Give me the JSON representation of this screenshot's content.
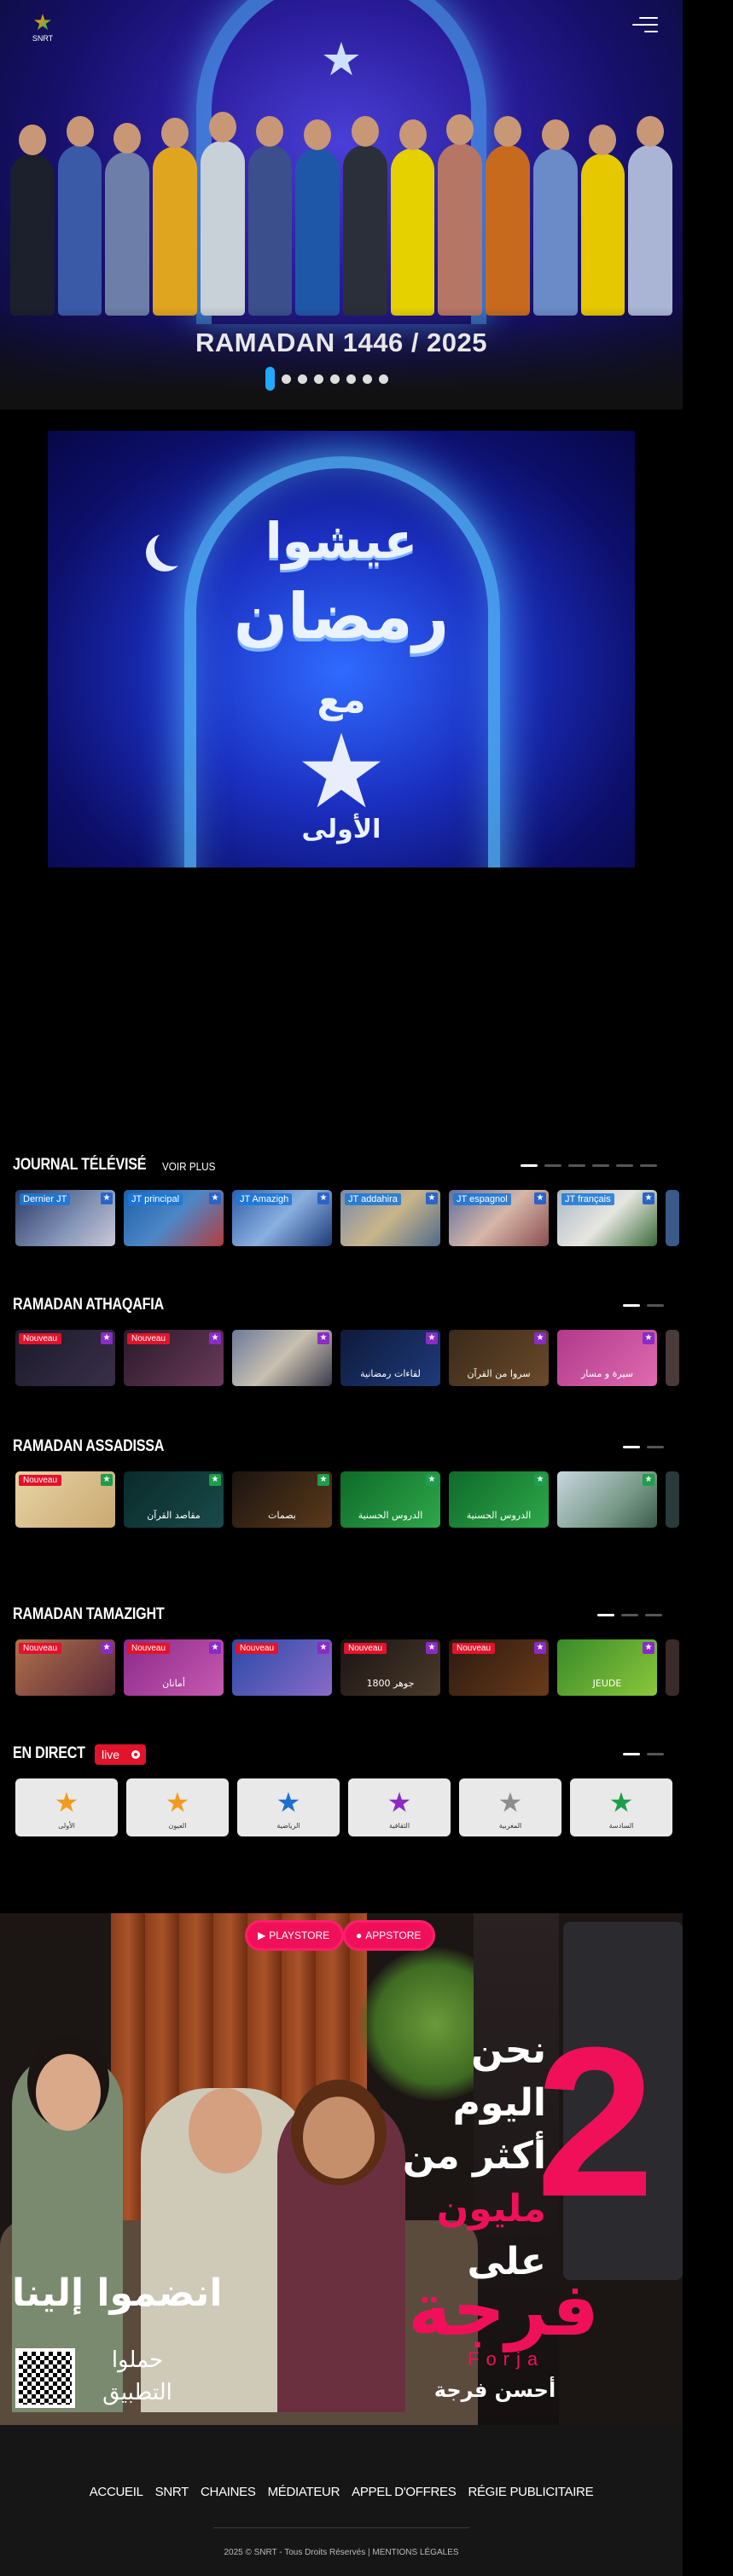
{
  "header": {
    "logo_text": "SNRT",
    "logo_icon": "snrt-star-logo",
    "menu_icon": "menu-icon"
  },
  "hero": {
    "caption": "RAMADAN 1446 / 2025",
    "slide_count": 8,
    "active_slide": 1,
    "emblem_text": "الأولى"
  },
  "poster": {
    "line1": "عيشوا",
    "line2": "رمضان",
    "line3": "مع",
    "line4": "الأولى"
  },
  "sections": {
    "journal": {
      "title": "JOURNAL TÉLÉVISÉ",
      "more": "VOIR PLUS",
      "cards": [
        {
          "label": "Dernier JT"
        },
        {
          "label": "JT principal"
        },
        {
          "label": "JT Amazigh"
        },
        {
          "label": "JT addahira"
        },
        {
          "label": "JT espagnol"
        },
        {
          "label": "JT français"
        }
      ]
    },
    "athaqafia": {
      "title": "RAMADAN ATHAQAFIA",
      "cards": [
        {
          "badge": "Nouveau",
          "caption": ""
        },
        {
          "badge": "Nouveau",
          "caption": ""
        },
        {
          "badge": "",
          "caption": ""
        },
        {
          "badge": "",
          "caption": "لقاءات رمضانية"
        },
        {
          "badge": "",
          "caption": "سروا من القرآن"
        },
        {
          "badge": "",
          "caption": "سيرة و مسار"
        }
      ]
    },
    "assadissa": {
      "title": "RAMADAN ASSADISSA",
      "cards": [
        {
          "badge": "Nouveau",
          "caption": ""
        },
        {
          "badge": "",
          "caption": "مقاصد القرآن"
        },
        {
          "badge": "",
          "caption": "بصمات"
        },
        {
          "badge": "",
          "caption": "الدروس الحسنية"
        },
        {
          "badge": "",
          "caption": "الدروس الحسنية"
        },
        {
          "badge": "",
          "caption": ""
        }
      ]
    },
    "tamazight": {
      "title": "RAMADAN TAMAZIGHT",
      "cards": [
        {
          "badge": "Nouveau",
          "caption": ""
        },
        {
          "badge": "Nouveau",
          "caption": "أمانان"
        },
        {
          "badge": "Nouveau",
          "caption": ""
        },
        {
          "badge": "Nouveau",
          "caption": "جوهر 1800"
        },
        {
          "badge": "Nouveau",
          "caption": ""
        },
        {
          "badge": "",
          "caption": "JEUDE"
        }
      ]
    },
    "direct": {
      "title": "EN DIRECT",
      "live": "live",
      "channels": [
        {
          "name": "الأولى",
          "color": "#f39a1e"
        },
        {
          "name": "العيون",
          "color": "#f39a1e"
        },
        {
          "name": "الرياضية",
          "color": "#1e6fd1"
        },
        {
          "name": "الثقافية",
          "color": "#8a2bc6"
        },
        {
          "name": "المغربية",
          "color": "#8d8d8d"
        },
        {
          "name": "السادسة",
          "color": "#1e9e4a"
        }
      ]
    }
  },
  "ad": {
    "playstore": "PLAYSTORE",
    "appstore": "APPSTORE",
    "line1": "نحن",
    "line2": "اليوم",
    "line3": "أكثر من",
    "line4": "مليون",
    "line5": "على",
    "big_number": "2",
    "brand_ar": "فرجة",
    "brand_lat": "Forja",
    "slogan": "أحسن فرجة",
    "join": "انضموا إلينا",
    "download1": "حملوا",
    "download2": "التطبيق"
  },
  "footer": {
    "links": [
      "ACCUEIL",
      "SNRT",
      "CHAINES",
      "MÉDIATEUR",
      "APPEL D'OFFRES",
      "RÉGIE PUBLICITAIRE"
    ],
    "copyright": "2025 © SNRT - Tous Droits Réservés | MENTIONS LÉGALES"
  }
}
